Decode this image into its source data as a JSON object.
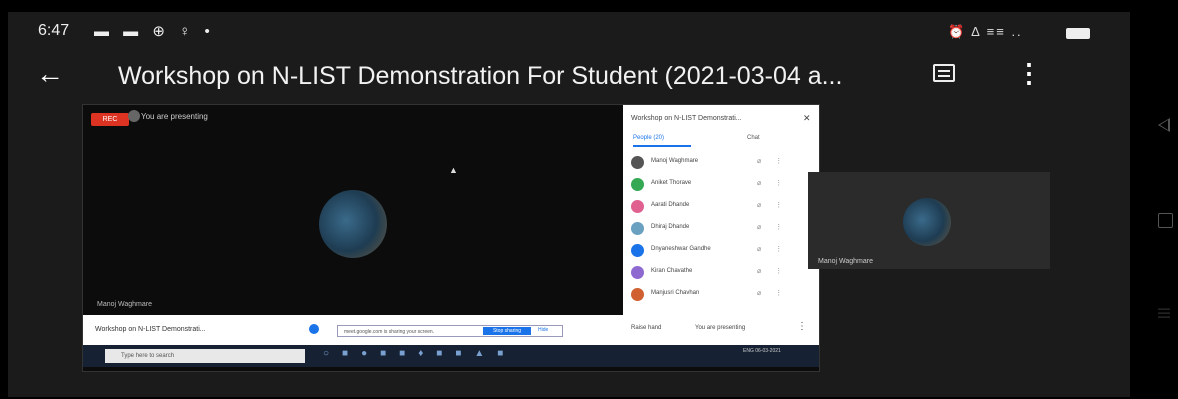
{
  "status_bar": {
    "time": "6:47",
    "left_icons": "▬ ▬ ⊕ ♀ •",
    "right_icons": "⏰ Δ ≡≡ .."
  },
  "header": {
    "title": "Workshop on N-LIST Demonstration For Student (2021-03-04 a..."
  },
  "meeting": {
    "rec_label": "REC",
    "presenting_label": "You are presenting",
    "presenter_name": "Manoj Waghmare",
    "panel": {
      "title": "Workshop on N-LIST Demonstrati...",
      "close": "✕",
      "tab_people": "People (20)",
      "tab_chat": "Chat",
      "participants": [
        {
          "name": "Manoj Waghmare",
          "color": "#555555"
        },
        {
          "name": "Aniket Thorave",
          "color": "#34a853"
        },
        {
          "name": "Aarati Dhande",
          "color": "#e06090"
        },
        {
          "name": "Dhiraj Dhande",
          "color": "#6aa0c0"
        },
        {
          "name": "Dnyaneshwar Gandhe",
          "color": "#1a73e8"
        },
        {
          "name": "Kiran Chavathe",
          "color": "#8e6ad0"
        },
        {
          "name": "Manjusri Chavhan",
          "color": "#d06030"
        }
      ]
    },
    "bottom": {
      "title": "Workshop on N-LIST Demonstrati...",
      "share_message": "meet.google.com is sharing your screen.",
      "stop_sharing": "Stop sharing",
      "hide": "Hide",
      "raise_hand": "Raise hand",
      "you_are_presenting": "You are presenting"
    },
    "taskbar": {
      "search_placeholder": "Type here to search",
      "clock": "ENG 06-03-2021"
    }
  },
  "tile": {
    "name": "Manoj Waghmare"
  }
}
